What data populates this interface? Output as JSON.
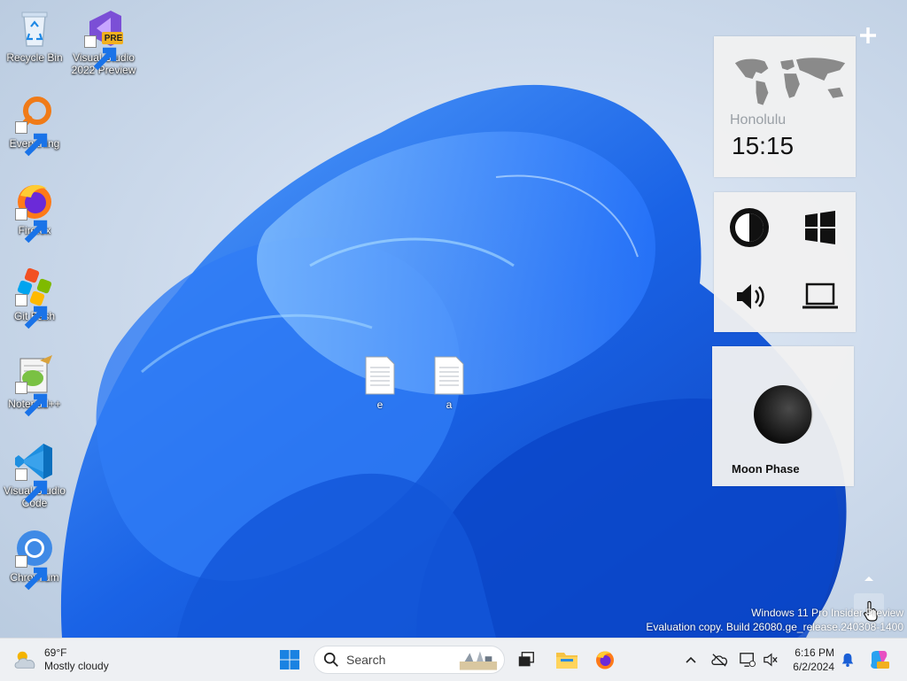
{
  "desktop": {
    "icons": [
      {
        "label": "Recycle Bin",
        "icon": "recycle-bin-icon"
      },
      {
        "label": "Visual Studio 2022 Preview",
        "icon": "visual-studio-preview-icon",
        "badge": "PRE"
      },
      {
        "label": "Everything",
        "icon": "everything-search-icon"
      },
      {
        "label": "Firefox",
        "icon": "firefox-icon"
      },
      {
        "label": "Git Bash",
        "icon": "git-bash-icon"
      },
      {
        "label": "Notepad++",
        "icon": "notepadpp-icon"
      },
      {
        "label": "Visual Studio Code",
        "icon": "vscode-icon"
      },
      {
        "label": "Chromium",
        "icon": "chromium-icon"
      }
    ],
    "files": [
      {
        "label": "e",
        "icon": "text-file-icon"
      },
      {
        "label": "a",
        "icon": "text-file-icon"
      }
    ]
  },
  "gadgets": {
    "clock": {
      "city": "Honolulu",
      "time": "15:15"
    },
    "controls": [
      "contrast-icon",
      "windows-logo-icon",
      "speaker-icon",
      "laptop-icon"
    ],
    "moon": {
      "label": "Moon Phase"
    }
  },
  "watermark": {
    "line1": "Windows 11 Pro Insider Preview",
    "line2": "Evaluation copy. Build 26080.ge_release.240308-1400"
  },
  "taskbar": {
    "weather": {
      "temp": "69°F",
      "condition": "Mostly cloudy"
    },
    "search": {
      "placeholder": "Search"
    },
    "clock": {
      "time": "6:16 PM",
      "date": "6/2/2024"
    }
  },
  "colors": {
    "accent": "#0067c0",
    "taskbar": "#eef0f3",
    "bloom": "#1560e8"
  }
}
